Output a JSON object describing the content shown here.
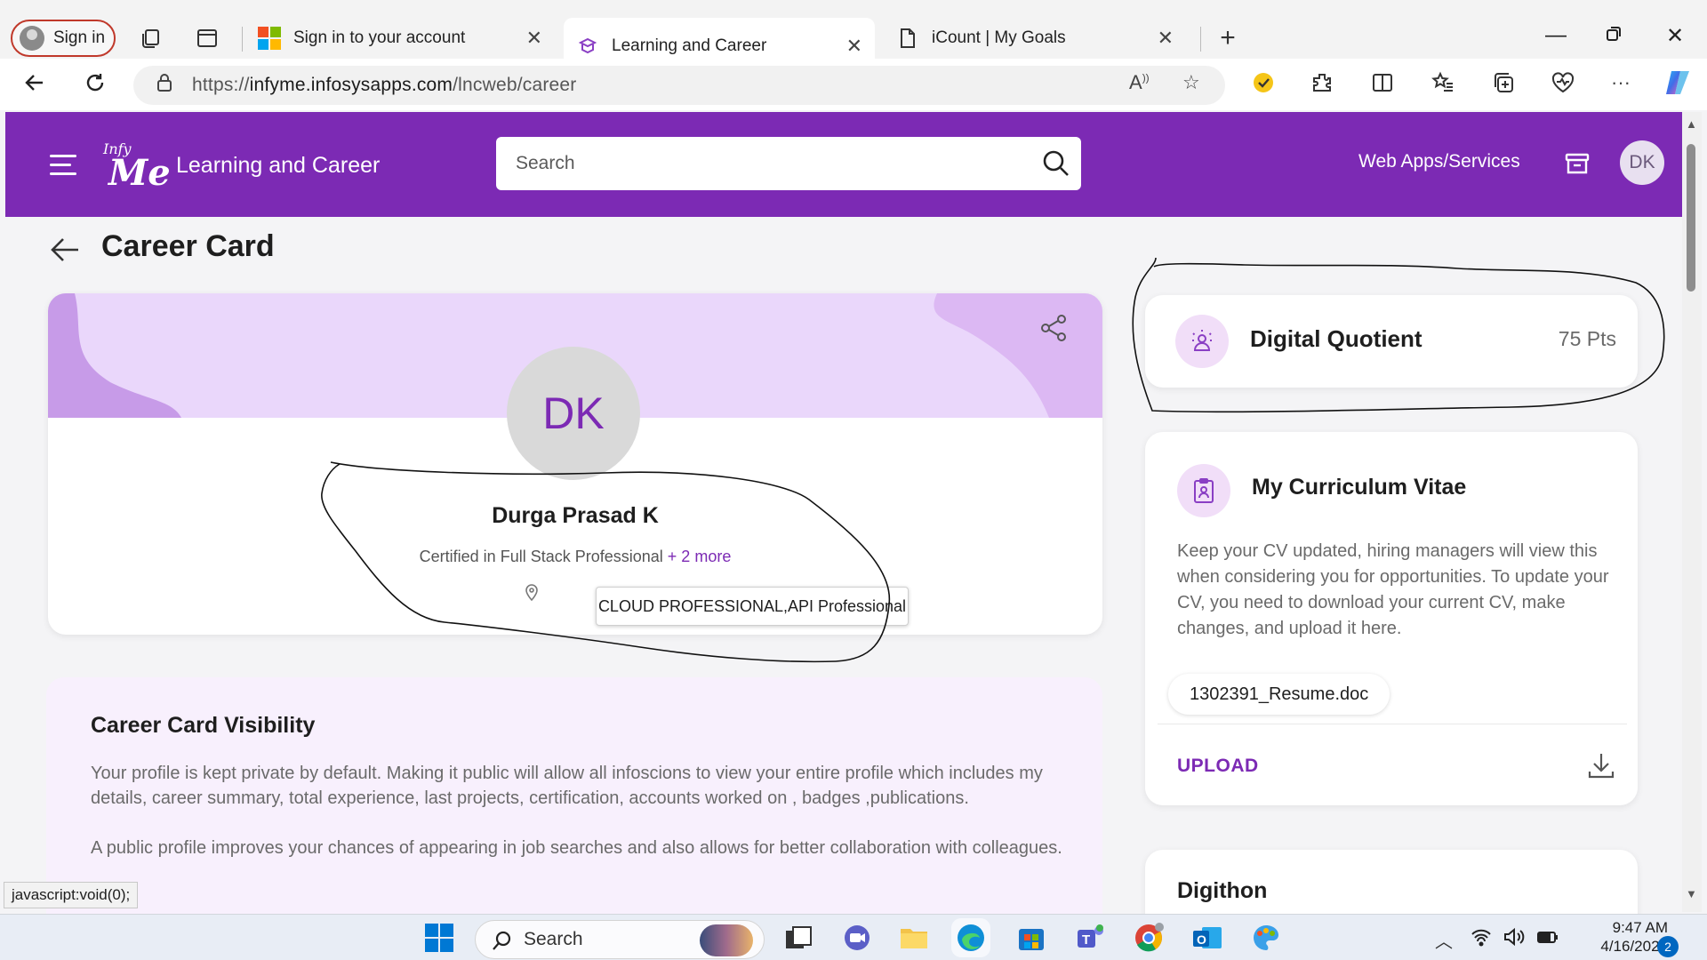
{
  "browser": {
    "signin_label": "Sign in",
    "tabs": [
      {
        "title": "Sign in to your account",
        "icon": "microsoft-logo-icon",
        "active": false
      },
      {
        "title": "Learning and Career",
        "icon": "learning-icon",
        "active": true
      },
      {
        "title": "iCount | My Goals",
        "icon": "page-icon",
        "active": false
      }
    ],
    "url_prefix": "https://",
    "url_host": "infyme.infosysapps.com",
    "url_path": "/lncweb/career",
    "status_text": "javascript:void(0);"
  },
  "header": {
    "logo_top": "Infy",
    "logo_bottom": "Me",
    "title": "Learning and Career",
    "search_placeholder": "Search",
    "web_apps_label": "Web Apps/Services",
    "user_initials": "DK",
    "accent": "#7c2ab4"
  },
  "page": {
    "title": "Career Card"
  },
  "career_card": {
    "initials": "DK",
    "name": "Durga Prasad K",
    "cert_text": "Certified in Full Stack Professional",
    "cert_more": "+ 2 more",
    "tooltip": "CLOUD PROFESSIONAL,API Professional"
  },
  "visibility": {
    "title": "Career Card Visibility",
    "para1": "Your profile is kept private by default. Making it public will allow all infoscions to view your entire profile which includes my details, career summary, total experience, last projects, certification, accounts worked on , badges ,publications.",
    "para2": "A public profile improves your chances of appearing in job searches and also allows for better collaboration with colleagues."
  },
  "digital_quotient": {
    "title": "Digital Quotient",
    "points": "75 Pts"
  },
  "cv": {
    "title": "My Curriculum Vitae",
    "description": "Keep your CV updated, hiring managers will view this when considering you for opportunities. To update your CV, you need to download your current CV, make changes, and upload it here.",
    "file_name": "1302391_Resume.doc",
    "upload_label": "UPLOAD"
  },
  "digithon": {
    "title": "Digithon"
  },
  "taskbar": {
    "search_label": "Search",
    "time": "9:47 AM",
    "date": "4/16/2024",
    "notification_count": "2"
  }
}
